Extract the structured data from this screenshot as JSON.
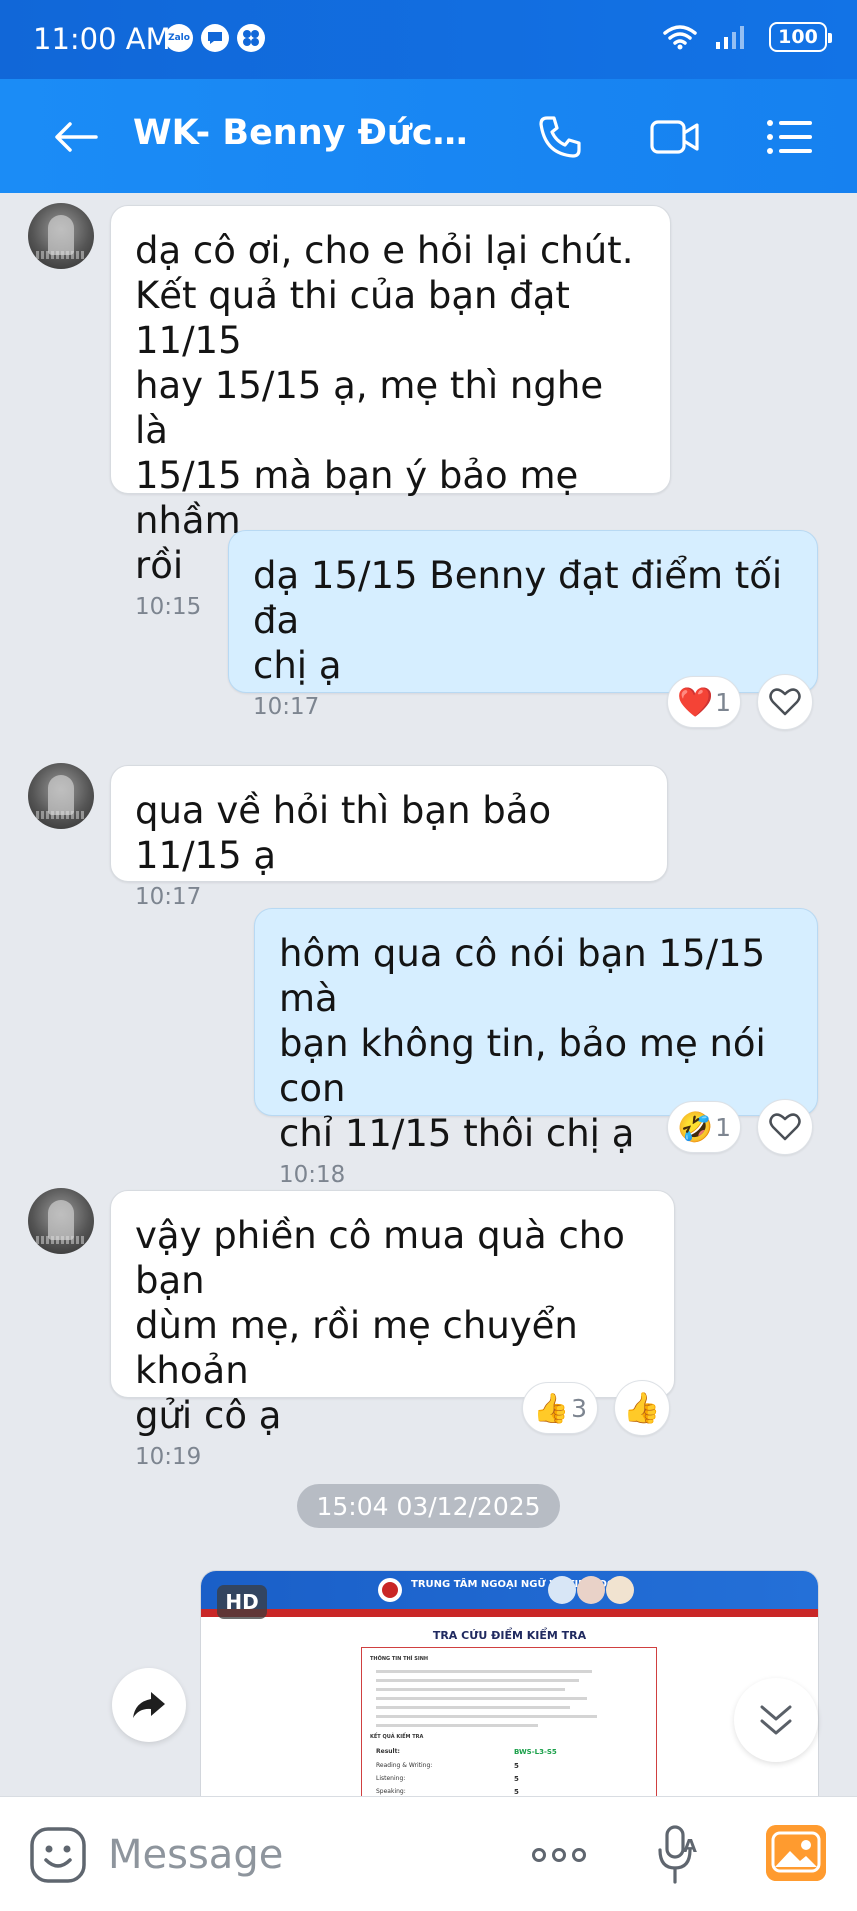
{
  "status_bar": {
    "time": "11:00 AM",
    "notification_icons": [
      "zalo-icon",
      "chat-bubble-icon",
      "pinwheel-icon"
    ],
    "zalo_label": "Zalo",
    "battery": "100"
  },
  "header": {
    "title": "WK- Benny Đức Bì...",
    "icons": [
      "back-arrow-icon",
      "phone-icon",
      "video-call-icon",
      "menu-list-icon"
    ],
    "accent_color": "#1b8cf6"
  },
  "messages": [
    {
      "direction": "incoming",
      "text": "dạ cô ơi, cho e hỏi lại chút.\nKết quả thi của bạn đạt 11/15\nhay 15/15 ạ, mẹ thì nghe là\n15/15 mà bạn ý bảo mẹ nhầm\nrồi",
      "time": "10:15"
    },
    {
      "direction": "outgoing",
      "text": "dạ 15/15 Benny đạt điểm tối đa\nchị ạ",
      "time": "10:17",
      "reaction": {
        "emoji": "❤️",
        "count": "1"
      }
    },
    {
      "direction": "incoming",
      "text": "qua về hỏi thì bạn bảo 11/15 ạ",
      "time": "10:17"
    },
    {
      "direction": "outgoing",
      "text": "hôm qua cô nói bạn 15/15 mà\nbạn không tin, bảo mẹ nói con\nchỉ 11/15 thôi chị ạ",
      "time": "10:18",
      "reaction": {
        "emoji": "🤣",
        "count": "1"
      }
    },
    {
      "direction": "incoming",
      "text": "vậy phiền cô mua quà cho bạn\ndùm mẹ, rồi mẹ chuyển khoản\ngửi cô ạ",
      "time": "10:19",
      "reaction": {
        "emoji": "👍",
        "count": "3"
      },
      "react_button_emoji": "👍"
    }
  ],
  "date_separator": "15:04 03/12/2025",
  "image_message": {
    "badge": "HD",
    "heading": "TRA CỨU ĐIỂM KIỂM TRA",
    "banner_title": "TRUNG TÂM NGOẠI NGỮ VÀ TIN HỌC",
    "section_info": "THÔNG TIN THÍ SINH",
    "section_result": "KẾT QUẢ KIỂM TRA",
    "result_label": "Result:",
    "result_value": "BWS-L3-S5",
    "skills": [
      {
        "name": "Reading & Writing:",
        "score": "5"
      },
      {
        "name": "Listening:",
        "score": "5"
      },
      {
        "name": "Speaking:",
        "score": "5"
      }
    ]
  },
  "input_bar": {
    "placeholder": "Message",
    "icons": [
      "emoji-icon",
      "more-dots-icon",
      "microphone-icon",
      "photo-icon"
    ]
  }
}
